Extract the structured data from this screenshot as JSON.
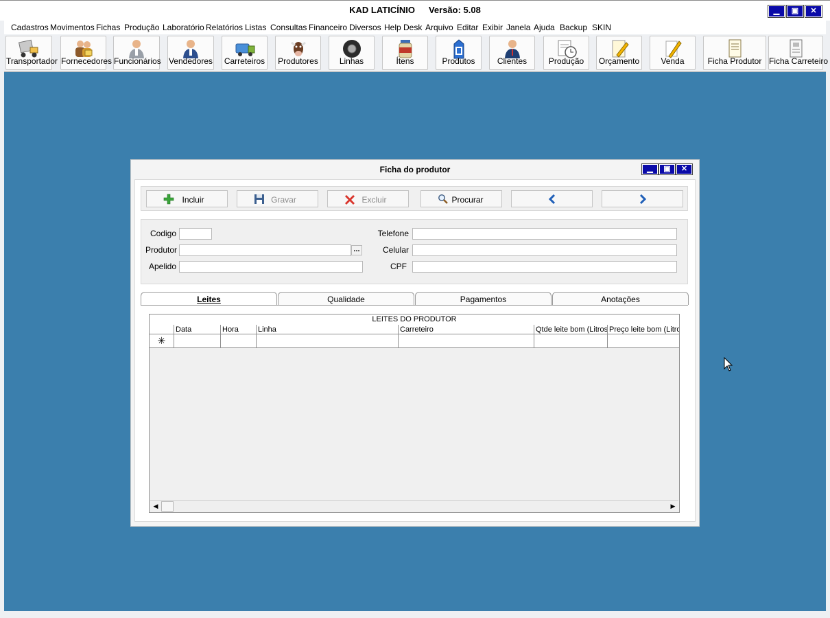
{
  "app": {
    "title": "KAD LATICÍNIO",
    "version": "Versão: 5.08",
    "window_controls": [
      "minimize-icon",
      "maximize-icon",
      "close-icon"
    ]
  },
  "menu": [
    "Cadastros",
    "Movimentos",
    "Fichas",
    "Produção",
    "Laboratório",
    "Relatórios",
    "Listas",
    "Consultas",
    "Financeiro",
    "Diversos",
    "Help Desk",
    "Arquivo",
    "Editar",
    "Exibir",
    "Janela",
    "Ajuda",
    "Backup",
    "SKIN"
  ],
  "toolbar": [
    {
      "label": "Transportador",
      "icon": "truck-icon"
    },
    {
      "label": "Fornecedores",
      "icon": "suppliers-icon"
    },
    {
      "label": "Funcionários",
      "icon": "employee-icon"
    },
    {
      "label": "Vendedores",
      "icon": "seller-icon"
    },
    {
      "label": "Carreteiros",
      "icon": "milk-truck-icon"
    },
    {
      "label": "Produtores",
      "icon": "cow-icon"
    },
    {
      "label": "Linhas",
      "icon": "tire-icon"
    },
    {
      "label": "Ítens",
      "icon": "jar-icon"
    },
    {
      "label": "Produtos",
      "icon": "milk-carton-icon"
    },
    {
      "label": "Clientes",
      "icon": "client-icon"
    },
    {
      "label": "Produção",
      "icon": "clock-document-icon"
    },
    {
      "label": "Orçamento",
      "icon": "pencil-paper-icon"
    },
    {
      "label": "Venda",
      "icon": "pencil-icon"
    },
    {
      "label": "Ficha Produtor",
      "icon": "document-icon"
    },
    {
      "label": "Ficha Carreteiro",
      "icon": "document-phone-icon"
    }
  ],
  "ficha": {
    "title": "Ficha do produtor",
    "actions": {
      "incluir": "Incluir",
      "gravar": "Gravar",
      "excluir": "Excluir",
      "procurar": "Procurar"
    },
    "fields": {
      "codigo": {
        "label": "Codigo",
        "value": ""
      },
      "produtor": {
        "label": "Produtor",
        "value": "",
        "lookup": "..."
      },
      "apelido": {
        "label": "Apelido",
        "value": ""
      },
      "telefone": {
        "label": "Telefone",
        "value": ""
      },
      "celular": {
        "label": "Celular",
        "value": ""
      },
      "cpf": {
        "label": "CPF",
        "value": ""
      }
    },
    "tabs": [
      {
        "label": "Leites",
        "active": true
      },
      {
        "label": "Qualidade",
        "active": false
      },
      {
        "label": "Pagamentos",
        "active": false
      },
      {
        "label": "Anotações",
        "active": false
      }
    ],
    "grid": {
      "caption": "LEITES DO PRODUTOR",
      "columns": [
        "Data",
        "Hora",
        "Linha",
        "Carreteiro",
        "Qtde leite bom (Litros)",
        "Preço leite bom (Litro)"
      ],
      "new_row_marker": "✳",
      "rows": []
    }
  }
}
